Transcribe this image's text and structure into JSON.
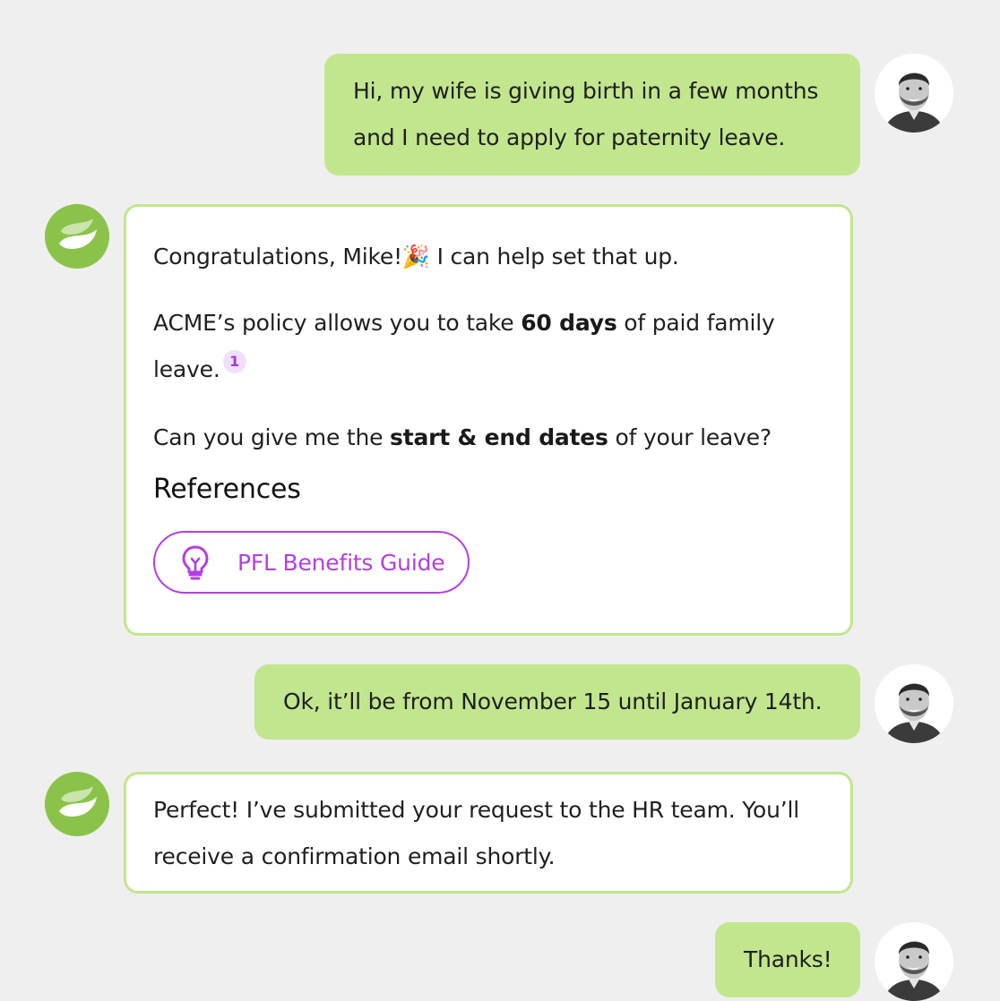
{
  "user": {
    "avatar_icon": "user-avatar-photo"
  },
  "bot": {
    "avatar_icon": "leaf-logo-icon"
  },
  "messages": {
    "m1": {
      "line1": "Hi, my wife is giving birth in a few months",
      "line2": "and I need to apply for paternity leave."
    },
    "m2": {
      "p1_text": "Congratulations, Mike!",
      "p1_emoji": "🎉",
      "p1_after": " I can help set that up.",
      "p2_pre": "ACME’s policy allows you to take ",
      "p2_bold": "60 days",
      "p2_post": " of paid family",
      "p2_line2": "leave.",
      "citation": "1",
      "p3_pre": "Can you give me the ",
      "p3_bold": "start & end dates",
      "p3_post": " of your leave?",
      "references_heading": "References",
      "reference_label": "PFL Benefits Guide",
      "reference_icon": "lightbulb-icon"
    },
    "m3": {
      "text": "Ok, it’ll be from November 15 until January 14th."
    },
    "m4": {
      "line1": "Perfect! I’ve submitted your request to the HR team. You’ll",
      "line2": "receive a confirmation email shortly."
    },
    "m5": {
      "text": "Thanks!"
    }
  },
  "colors": {
    "background": "#efefef",
    "user_bubble": "#c2e68e",
    "bot_border": "#c2e68e",
    "bot_avatar": "#8bc34a",
    "accent_purple": "#b43ee0"
  }
}
